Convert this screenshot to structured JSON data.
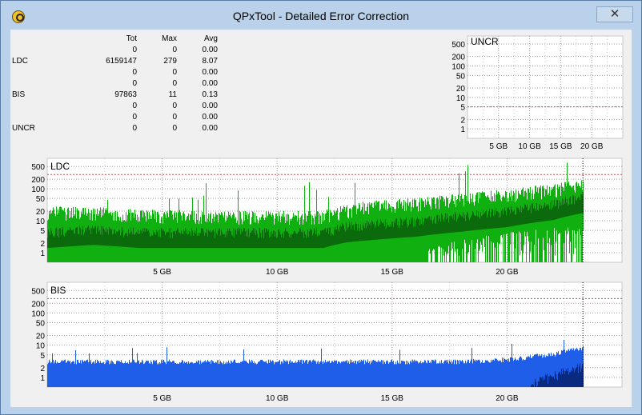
{
  "window": {
    "title": "QPxTool - Detailed Error Correction",
    "close_glyph": "✕",
    "app_icon": "qpxtool-icon"
  },
  "stats": {
    "headers": [
      "",
      "Tot",
      "Max",
      "Avg"
    ],
    "rows": [
      [
        "",
        "0",
        "0",
        "0.00"
      ],
      [
        "LDC",
        "6159147",
        "279",
        "8.07"
      ],
      [
        "",
        "0",
        "0",
        "0.00"
      ],
      [
        "",
        "0",
        "0",
        "0.00"
      ],
      [
        "BIS",
        "97863",
        "11",
        "0.13"
      ],
      [
        "",
        "0",
        "0",
        "0.00"
      ],
      [
        "",
        "0",
        "0",
        "0.00"
      ],
      [
        "UNCR",
        "0",
        "0",
        "0.00"
      ]
    ]
  },
  "colors": {
    "ldc_light": "#11b011",
    "ldc_dark": "#0b6a0b",
    "bis_light": "#1f5ee8",
    "bis_dark": "#0a2a80",
    "threshold": "#c0504d",
    "grid": "#9a9a9a"
  },
  "chart_data": [
    {
      "type": "area",
      "title": "UNCR",
      "y_scale": "log",
      "y_ticks": [
        "500",
        "200",
        "100",
        "50",
        "20",
        "10",
        "5",
        "2",
        "1"
      ],
      "x_ticks": [
        "5 GB",
        "10 GB",
        "15 GB",
        "20 GB"
      ],
      "x_range_gb": [
        0,
        25
      ],
      "threshold": 5,
      "series": [
        {
          "values": []
        }
      ]
    },
    {
      "type": "area",
      "title": "LDC",
      "y_scale": "log",
      "y_ticks": [
        "500",
        "200",
        "100",
        "50",
        "20",
        "10",
        "5",
        "2",
        "1"
      ],
      "x_ticks": [
        "5 GB",
        "10 GB",
        "15 GB",
        "20 GB"
      ],
      "x_range_gb": [
        0,
        25
      ],
      "data_end_gb": 23.3,
      "threshold": 280,
      "series": [
        {
          "x": [
            0,
            2,
            4,
            6,
            8,
            10,
            12,
            13,
            14,
            16,
            18,
            20,
            22,
            23.3
          ],
          "values": [
            18,
            18,
            15,
            14,
            13,
            13,
            14,
            20,
            28,
            35,
            45,
            65,
            90,
            130
          ]
        },
        {
          "x": [
            0,
            2,
            4,
            6,
            8,
            10,
            12,
            13,
            14,
            16,
            18,
            20,
            22,
            23.3
          ],
          "values": [
            4,
            5,
            4,
            4,
            4,
            4,
            4,
            6,
            7,
            9,
            13,
            18,
            30,
            50
          ]
        }
      ]
    },
    {
      "type": "area",
      "title": "BIS",
      "y_scale": "log",
      "y_ticks": [
        "500",
        "200",
        "100",
        "50",
        "20",
        "10",
        "5",
        "2",
        "1"
      ],
      "x_ticks": [
        "5 GB",
        "10 GB",
        "15 GB",
        "20 GB"
      ],
      "x_range_gb": [
        0,
        25
      ],
      "data_end_gb": 23.3,
      "threshold": 280,
      "series": [
        {
          "x": [
            0,
            2,
            4,
            6,
            8,
            10,
            12,
            14,
            16,
            18,
            20,
            22,
            23.3
          ],
          "values": [
            3,
            3,
            3,
            3,
            3,
            3,
            3,
            3,
            3,
            3,
            3.5,
            5,
            8
          ]
        },
        {
          "x": [
            0,
            2,
            4,
            6,
            8,
            10,
            12,
            14,
            16,
            18,
            20,
            22,
            23.3
          ],
          "values": [
            0,
            0,
            0,
            0,
            0,
            0,
            0,
            0,
            0,
            0,
            0,
            1,
            2
          ]
        }
      ]
    }
  ]
}
